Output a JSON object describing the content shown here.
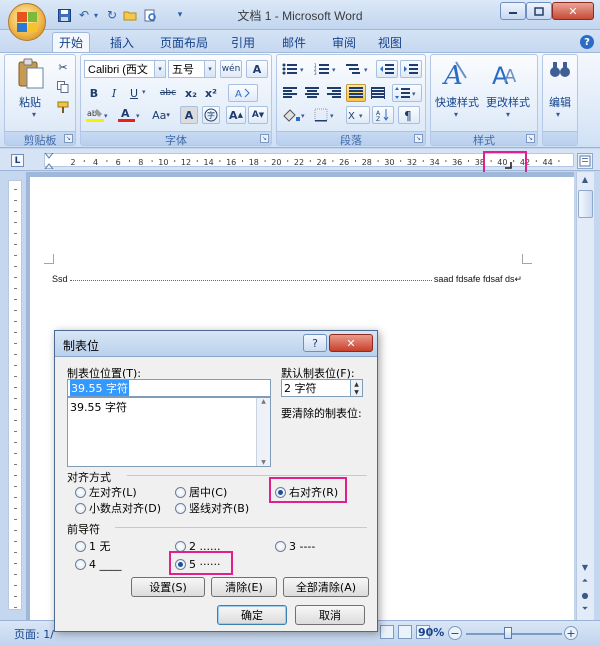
{
  "window": {
    "title": "文档 1 - Microsoft Word"
  },
  "qat": {
    "icons": [
      "save-icon",
      "undo-icon",
      "redo-icon",
      "open-icon",
      "print-preview-icon",
      "customize-icon"
    ]
  },
  "tabs": [
    "开始",
    "插入",
    "页面布局",
    "引用",
    "邮件",
    "审阅",
    "视图"
  ],
  "ribbon": {
    "clipboard": {
      "paste": "粘贴",
      "label": "剪贴板"
    },
    "font": {
      "font_name": "Calibri (西文",
      "font_size": "五号",
      "wen": "wén",
      "label": "字体",
      "bold": "B",
      "italic": "I",
      "underline": "U",
      "strike": "abc",
      "sub": "x₂",
      "sup": "x²",
      "change_case": "Aa",
      "char_border": "A",
      "grow": "A",
      "shrink": "A"
    },
    "paragraph": {
      "label": "段落"
    },
    "styles": {
      "quick": "快速样式",
      "change": "更改样式",
      "label": "样式"
    },
    "editing": {
      "label": "编辑"
    }
  },
  "ruler": {
    "ticks": [
      "2",
      "4",
      "6",
      "8",
      "10",
      "12",
      "14",
      "16",
      "18",
      "20",
      "22",
      "24",
      "26",
      "28",
      "30",
      "32",
      "34",
      "36",
      "38",
      "40",
      "42",
      "44"
    ]
  },
  "document": {
    "left_text": "Ssd",
    "right_text": "saad fdsafe fdsaf ds↵"
  },
  "dialog": {
    "title": "制表位",
    "tab_pos_label": "制表位位置(T):",
    "tab_pos_value": "39.55 字符",
    "tab_list": [
      "39.55 字符"
    ],
    "default_label": "默认制表位(F):",
    "default_value": "2 字符",
    "clear_label": "要清除的制表位:",
    "align_label": "对齐方式",
    "align": {
      "left": "左对齐(L)",
      "center": "居中(C)",
      "right": "右对齐(R)",
      "decimal": "小数点对齐(D)",
      "bar": "竖线对齐(B)"
    },
    "leader_label": "前导符",
    "leader": {
      "l1": "1 无",
      "l2": "2 ......",
      "l3": "3 ----",
      "l4": "4 ____",
      "l5": "5 ······"
    },
    "buttons": {
      "set": "设置(S)",
      "clear": "清除(E)",
      "clear_all": "全部清除(A)",
      "ok": "确定",
      "cancel": "取消"
    }
  },
  "status": {
    "page": "页面: 1/",
    "zoom": "90%"
  }
}
